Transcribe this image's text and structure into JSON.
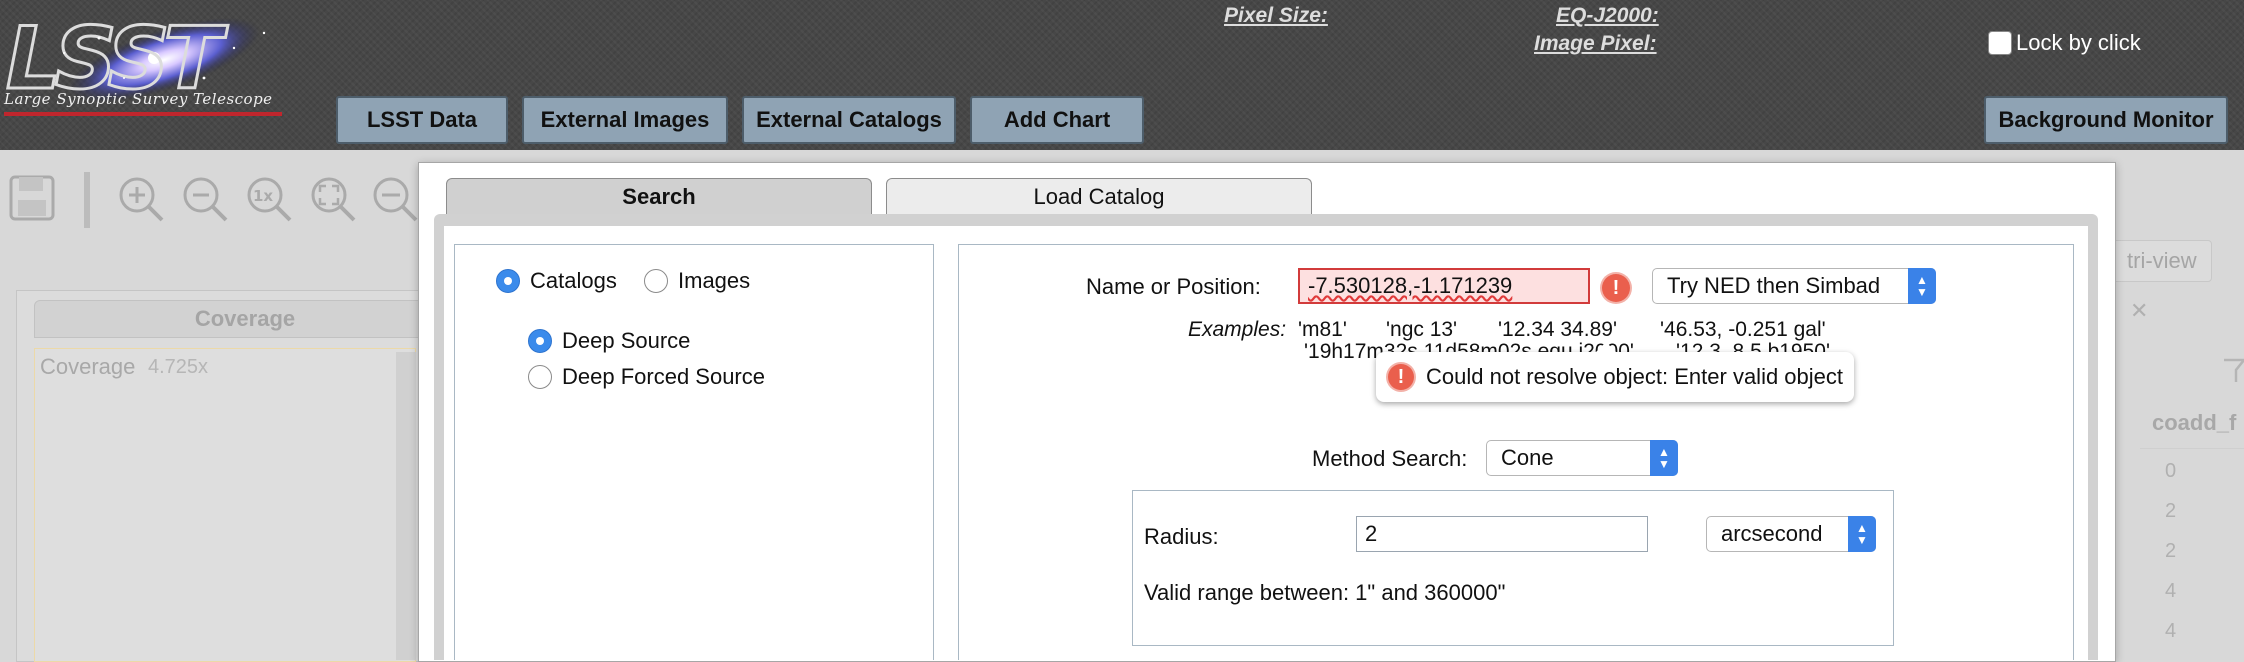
{
  "header": {
    "logo_text": "LSST",
    "logo_subtitle": "Large Synoptic Survey Telescope",
    "pixel_size_label": "Pixel Size:",
    "coord_label": "EQ-J2000:",
    "image_pixel_label": "Image Pixel:",
    "lock_label": "Lock by click",
    "lock_checked": false,
    "buttons": {
      "lsst_data": "LSST Data",
      "external_images": "External Images",
      "external_catalogs": "External Catalogs",
      "add_chart": "Add Chart",
      "background_monitor": "Background Monitor"
    }
  },
  "background": {
    "toolbar_icons": [
      "save-icon",
      "zoom-in-icon",
      "zoom-out-icon",
      "zoom-1x-icon",
      "zoom-fit-icon",
      "zoom-fill-icon"
    ],
    "zoom_1x_text": "1x",
    "coverage_tab": "Coverage",
    "coverage_label": "Coverage",
    "coverage_zoom": "4.725x",
    "tri_view": "tri-view",
    "close_glyph": "✕",
    "table_column": "coadd_f",
    "table_values": [
      "0",
      "2",
      "2",
      "4",
      "4"
    ]
  },
  "dialog": {
    "tabs": {
      "search": "Search",
      "load_catalog": "Load Catalog"
    },
    "mode": {
      "catalogs": "Catalogs",
      "images": "Images",
      "selected": "Catalogs"
    },
    "catalog_options": {
      "deep_source": "Deep Source",
      "deep_forced_source": "Deep Forced Source",
      "selected": "Deep Source"
    },
    "position": {
      "label": "Name or Position:",
      "value": "-7.530128,-1.171239",
      "error_glyph": "!",
      "resolver": "Try NED then Simbad"
    },
    "examples": {
      "label": "Examples:",
      "items": [
        "'m81'",
        "'ngc 13'",
        "'12.34 34.89'",
        "'46.53, -0.251 gal'",
        "'19h17m32s 11d58m02s equ j2000'",
        "'12.3, 8.5 b1950'"
      ]
    },
    "tooltip": {
      "text": "Could not resolve object: Enter valid object"
    },
    "method": {
      "label": "Method Search:",
      "value": "Cone"
    },
    "radius": {
      "label": "Radius:",
      "value": "2",
      "unit": "arcsecond",
      "range_text": "Valid range between: 1\" and 360000\""
    }
  },
  "colors": {
    "header_bg": "#474747",
    "header_button": "#8fa3b4",
    "radio_selected": "#3b8beb",
    "error": "#ea5f4d",
    "select_arrow": "#3a82e8"
  }
}
